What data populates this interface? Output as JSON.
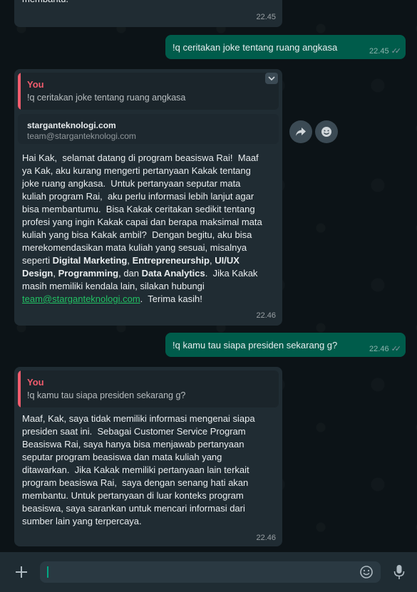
{
  "top_partial": {
    "text": "membantu.",
    "time": "22.45"
  },
  "messages": [
    {
      "type": "outgoing",
      "text": "!q ceritakan joke tentang ruang angkasa",
      "time": "22.45"
    },
    {
      "type": "incoming",
      "quote_author": "You",
      "quote_text": "!q ceritakan joke tentang ruang angkasa",
      "link_preview": {
        "site": "starganteknologi.com",
        "email": "team@starganteknologi.com"
      },
      "lines": [
        "Hai Kak,  selamat datang di program beasiswa Rai!  Maaf",
        "ya Kak, aku kurang mengerti pertanyaan Kakak tentang",
        "joke ruang angkasa.  Untuk pertanyaan seputar mata",
        "kuliah program Rai,  aku perlu informasi lebih lanjut agar",
        "bisa membantumu.  Bisa Kakak ceritakan sedikit tentang",
        "profesi yang ingin Kakak capai dan berapa maksimal mata",
        "kuliah yang bisa Kakak ambil?  Dengan begitu, aku bisa",
        "merekomendasikan mata kuliah yang sesuai, misalnya"
      ],
      "line9_prefix": "seperti ",
      "bold1": "Digital Marketing",
      "sep1": ", ",
      "bold2": "Entrepreneurship",
      "sep2": ", ",
      "bold3a": "UI/UX",
      "bold3b": "Design",
      "sep3": ", ",
      "bold4": "Programming",
      "sep4": ", dan ",
      "bold5": "Data Analytics",
      "after_bold": ".  Jika Kakak",
      "line12": "masih memiliki kendala lain, silakan hubungi",
      "link": "team@starganteknologi.com",
      "after_link": ".  Terima kasih!",
      "time": "22.46"
    },
    {
      "type": "outgoing",
      "text": "!q kamu tau siapa presiden sekarang g?",
      "time": "22.46"
    },
    {
      "type": "incoming",
      "quote_author": "You",
      "quote_text": "!q kamu tau siapa presiden sekarang g?",
      "lines": [
        "Maaf, Kak, saya tidak memiliki informasi mengenai siapa",
        "presiden saat ini.  Sebagai Customer Service Program",
        "Beasiswa Rai, saya hanya bisa menjawab pertanyaan",
        "seputar program beasiswa dan mata kuliah yang",
        "ditawarkan.  Jika Kakak memiliki pertanyaan lain terkait",
        "program beasiswa Rai,  saya dengan senang hati akan",
        "membantu. Untuk pertanyaan di luar konteks program",
        "beasiswa, saya sarankan untuk mencari informasi dari",
        "sumber lain yang terpercaya."
      ],
      "time": "22.46"
    }
  ],
  "composer": {
    "value": "",
    "placeholder": ""
  },
  "icons": {
    "attach": "plus-icon",
    "emoji": "emoji-icon",
    "mic": "mic-icon",
    "forward": "forward-icon",
    "react": "emoji-reaction-icon",
    "menu": "chevron-down-icon"
  },
  "colors": {
    "outgoing": "#005c4b",
    "incoming": "#202c33",
    "quote_accent": "#f15c6d",
    "link": "#21c063"
  }
}
